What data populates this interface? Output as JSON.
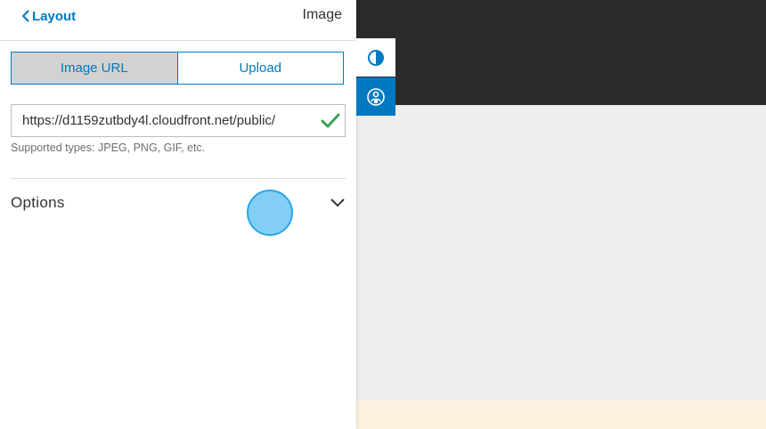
{
  "header": {
    "back_label": "Layout",
    "title": "Image"
  },
  "source_tabs": [
    {
      "label": "Image URL",
      "active": true
    },
    {
      "label": "Upload",
      "active": false
    }
  ],
  "url_field": {
    "value": "https://d1159zutbdy4l.cloudfront.net/public/",
    "valid": true
  },
  "hint": "Supported types: JPEG, PNG, GIF, etc.",
  "options": {
    "label": "Options",
    "expanded": false
  },
  "side_tabs": [
    {
      "icon": "contrast-icon"
    },
    {
      "icon": "accessibility-icon"
    }
  ],
  "colors": {
    "accent": "#0079c1",
    "valid_check": "#35a853",
    "preview_dark": "#2b2b2b",
    "preview_light": "#efefef",
    "preview_cream": "#fbf1de"
  }
}
